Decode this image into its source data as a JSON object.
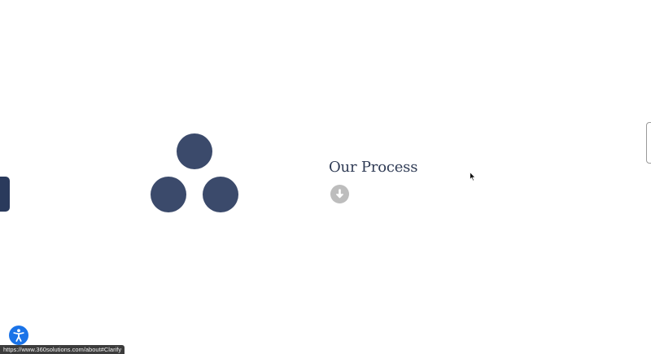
{
  "section": {
    "title": "Our Process"
  },
  "icons": {
    "process_graphic": "three-circles-icon",
    "scroll_down": "arrow-down-icon",
    "accessibility": "accessibility-icon",
    "cursor": "mouse-pointer-icon"
  },
  "colors": {
    "circle": "#3b4a6b",
    "title": "#2f3b55",
    "scroll_button": "#bdbdbd",
    "side_tab": "#2a3a5c",
    "accessibility_button": "#1a73e8"
  },
  "status_bar": {
    "url": "https://www.360solutions.com/about#Clarify"
  }
}
